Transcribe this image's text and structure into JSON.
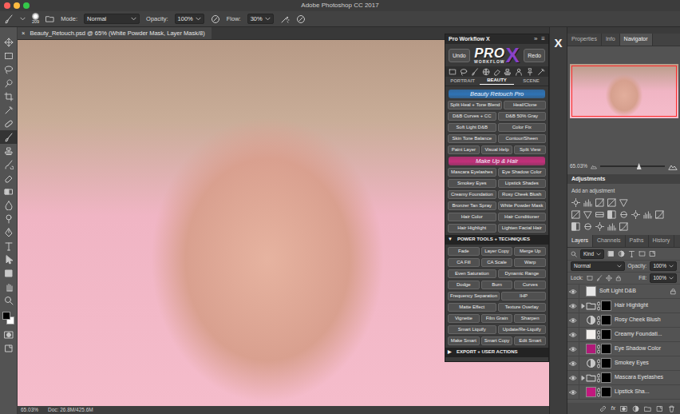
{
  "window": {
    "title": "Adobe Photoshop CC 2017",
    "controls": [
      {
        "color": "#fc605c"
      },
      {
        "color": "#fdbc40"
      },
      {
        "color": "#34c84a"
      }
    ]
  },
  "options_bar": {
    "brush_size": "209",
    "mode_label": "Mode:",
    "mode": "Normal",
    "opacity_label": "Opacity:",
    "opacity": "100%",
    "flow_label": "Flow:",
    "flow": "30%"
  },
  "document": {
    "close": "×",
    "title": "Beauty_Retouch.psd @ 65% (White Powder Mask, Layer Mask/8)"
  },
  "toolbar": {
    "tools": [
      {
        "selected": false
      },
      {
        "selected": false
      },
      {
        "selected": false
      },
      {
        "selected": false
      },
      {
        "selected": false
      },
      {
        "selected": false
      },
      {
        "selected": false
      },
      {
        "selected": true
      },
      {
        "selected": false
      },
      {
        "selected": false
      },
      {
        "selected": false
      },
      {
        "selected": false
      },
      {
        "selected": false
      },
      {
        "selected": false
      },
      {
        "selected": false
      },
      {
        "selected": false
      },
      {
        "selected": false
      },
      {
        "selected": false
      },
      {
        "selected": false
      },
      {
        "selected": false
      }
    ],
    "foreground": "#000000",
    "background": "#ffffff"
  },
  "status_bar": {
    "zoom": "65.03%",
    "doc": "Doc: 26.8M/425.6M"
  },
  "pro_panel": {
    "title": "Pro Workflow X",
    "collapse": "»",
    "menu": "≡",
    "undo": "Undo",
    "redo": "Redo",
    "logo": {
      "main": "PRO",
      "mark": "X",
      "sub": "WORKFLOW"
    },
    "tabs": [
      {
        "label": "PORTRAIT",
        "selected": false
      },
      {
        "label": "BEAUTY",
        "selected": true
      },
      {
        "label": "SCENE",
        "selected": false
      }
    ],
    "sections": [
      {
        "kind": "banner",
        "title": "Beauty Retouch Pro",
        "color": "#2f73b5",
        "rows": [
          [
            "Split Heal + Tone Blend",
            "Heal/Clone"
          ],
          [
            "D&B Curves + CC",
            "D&B 50% Gray"
          ],
          [
            "Soft Light D&B",
            "Color Fix"
          ],
          [
            "Skin Tone Balance",
            "Contour/Sheen"
          ],
          [
            "Paint Layer",
            "Visual Help",
            "Split View"
          ]
        ]
      },
      {
        "kind": "banner",
        "title": "Make Up & Hair",
        "color": "#c2307a",
        "rows": [
          [
            "Mascara Eyelashes",
            "Eye Shadow Color"
          ],
          [
            "Smokey Eyes",
            "Lipstick Shades"
          ],
          [
            "Creamy Foundation",
            "Rosy Cheek Blush"
          ],
          [
            "Bronzer Tan Spray",
            "White Powder Mask"
          ],
          [
            "Hair Color",
            "Hair Conditioner"
          ],
          [
            "Hair Highlight",
            "Lighten Facial Hair"
          ]
        ]
      },
      {
        "kind": "header",
        "arrow": "▼",
        "title": "POWER TOOLS + TECHNIQUES",
        "expanded": true,
        "rows": [
          [
            "Fade",
            "Layer Copy",
            "Merge Up"
          ],
          [
            "CA Fill",
            "CA Scale",
            "Warp"
          ],
          [
            "Even Saturation",
            "Dynamic Range"
          ],
          [
            "Dodge",
            "Burn",
            "Curves"
          ],
          [
            "Frequency Separation",
            "IHP"
          ],
          [
            "Matte Effect",
            "Texture Overlay"
          ],
          [
            "Vignette",
            "Film Grain",
            "Sharpen"
          ],
          [
            "Smart Liquify",
            "Update/Re-Liquify"
          ],
          [
            "Make Smart",
            "Smart Copy",
            "Edit Smart"
          ]
        ]
      },
      {
        "kind": "header",
        "arrow": "▶",
        "title": "EXPORT + USER ACTIONS",
        "expanded": false,
        "rows": []
      }
    ]
  },
  "side_strip": {
    "label": "X"
  },
  "navigator_panel": {
    "tabs": [
      {
        "label": "Properties",
        "selected": false
      },
      {
        "label": "Info",
        "selected": false
      },
      {
        "label": "Navigator",
        "selected": true
      }
    ],
    "zoom": "65.03%",
    "level": 0.6
  },
  "adjustments": {
    "title": "Adjustments",
    "hint": "Add an adjustment"
  },
  "layers_panel": {
    "tabs": [
      {
        "label": "Layers",
        "selected": true
      },
      {
        "label": "Channels",
        "selected": false
      },
      {
        "label": "Paths",
        "selected": false
      },
      {
        "label": "History",
        "selected": false
      }
    ],
    "filter": "Kind",
    "blend_mode": "Normal",
    "opacity_label": "Opacity:",
    "opacity": "100%",
    "lock_label": "Lock:",
    "fill_label": "Fill:",
    "fill": "100%",
    "fx": "fx",
    "layers": [
      {
        "name": "Soft Light D&B",
        "visible": true,
        "kind": "fill",
        "color": "#e6e6e6",
        "mask": false,
        "locked": true
      },
      {
        "name": "Hair Highlight",
        "visible": true,
        "kind": "group",
        "expanded": false,
        "mask": true,
        "locked": false
      },
      {
        "name": "Rosy Cheek Blush",
        "visible": true,
        "kind": "adjustment",
        "mask": true,
        "locked": false
      },
      {
        "name": "Creamy Foundati...",
        "visible": true,
        "kind": "fill",
        "color": "#f2efec",
        "mask": true,
        "locked": false
      },
      {
        "name": "Eye Shadow Color",
        "visible": true,
        "kind": "fill",
        "color": "#b01a78",
        "mask": true,
        "locked": false
      },
      {
        "name": "Smokey Eyes",
        "visible": true,
        "kind": "adjustment",
        "mask": true,
        "locked": false
      },
      {
        "name": "Mascara Eyelashes",
        "visible": true,
        "kind": "group",
        "expanded": false,
        "mask": true,
        "locked": false
      },
      {
        "name": "Lipstick Sha...",
        "visible": true,
        "kind": "fill",
        "color": "#c2197e",
        "mask": true,
        "locked": false
      }
    ]
  }
}
